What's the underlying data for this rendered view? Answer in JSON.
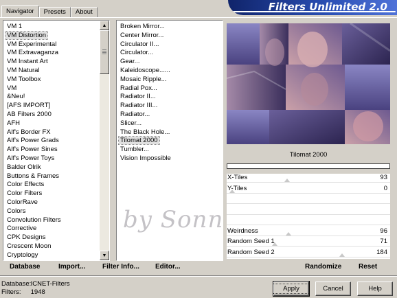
{
  "tabs": [
    {
      "label": "Navigator",
      "active": true
    },
    {
      "label": "Presets",
      "active": false
    },
    {
      "label": "About",
      "active": false
    }
  ],
  "banner": {
    "title": "Filters Unlimited 2.0"
  },
  "categories": [
    "VM 1",
    "VM Distortion",
    "VM Experimental",
    "VM Extravaganza",
    "VM Instant Art",
    "VM Natural",
    "VM Toolbox",
    "VM",
    "&Neu!",
    "[AFS IMPORT]",
    "AB Filters 2000",
    "AFH",
    "Alf's Border FX",
    "Alf's Power Grads",
    "Alf's Power Sines",
    "Alf's Power Toys",
    "Balder Olrik",
    "Buttons & Frames",
    "Color Effects",
    "Color Filters",
    "ColorRave",
    "Colors",
    "Convolution Filters",
    "Corrective",
    "CPK Designs",
    "Crescent Moon",
    "Cryptology"
  ],
  "selected_category": "VM Distortion",
  "filters": [
    "Broken Mirror...",
    "Center Mirror...",
    "Circulator II...",
    "Circulator...",
    "Gear...",
    "Kaleidoscope......",
    "Mosaic Ripple...",
    "Radial Pox...",
    "Radiator II...",
    "Radiator III...",
    "Radiator...",
    "Slicer...",
    "The Black Hole...",
    "Tilomat 2000",
    "Tumbler...",
    "Vision Impossible"
  ],
  "selected_filter": "Tilomat 2000",
  "watermark": "by Sonni",
  "preview": {
    "current_filter": "Tilomat 2000"
  },
  "params": [
    {
      "label": "X-Tiles",
      "value": "93",
      "fraction": 0.36
    },
    {
      "label": "Y-Tiles",
      "value": "0",
      "fraction": 0.0
    },
    {
      "label": "",
      "value": "",
      "fraction": null
    },
    {
      "label": "",
      "value": "",
      "fraction": null
    },
    {
      "label": "",
      "value": "",
      "fraction": null
    },
    {
      "label": "Weirdness",
      "value": "96",
      "fraction": 0.37
    },
    {
      "label": "Random Seed 1",
      "value": "71",
      "fraction": 0.28
    },
    {
      "label": "Random Seed 2",
      "value": "184",
      "fraction": 0.72
    }
  ],
  "buttons": {
    "database": "Database",
    "import": "Import...",
    "filter_info": "Filter Info...",
    "editor": "Editor...",
    "randomize": "Randomize",
    "reset": "Reset",
    "apply": "Apply",
    "cancel": "Cancel",
    "help": "Help"
  },
  "status": {
    "database_label": "Database:",
    "database_value": "ICNET-Filters",
    "filters_label": "Filters:",
    "filters_value": "1948"
  }
}
